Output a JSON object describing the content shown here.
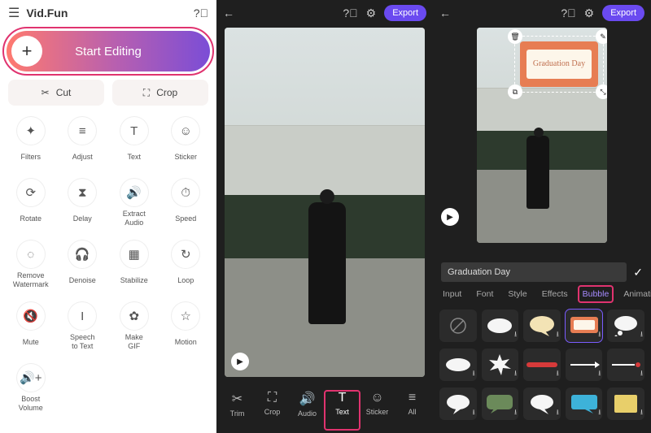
{
  "left": {
    "app_name": "Vid.Fun",
    "start_label": "Start Editing",
    "cut_label": "Cut",
    "crop_label": "Crop",
    "tools": [
      {
        "id": "filters",
        "label": "Filters",
        "icon": "✦"
      },
      {
        "id": "adjust",
        "label": "Adjust",
        "icon": "≡"
      },
      {
        "id": "text",
        "label": "Text",
        "icon": "T"
      },
      {
        "id": "sticker",
        "label": "Sticker",
        "icon": "☺"
      },
      {
        "id": "rotate",
        "label": "Rotate",
        "icon": "⟳"
      },
      {
        "id": "delay",
        "label": "Delay",
        "icon": "⧗"
      },
      {
        "id": "extract-audio",
        "label": "Extract Audio",
        "icon": "🔊"
      },
      {
        "id": "speed",
        "label": "Speed",
        "icon": "⏱"
      },
      {
        "id": "remove-watermark",
        "label": "Remove Watermark",
        "icon": "◌"
      },
      {
        "id": "denoise",
        "label": "Denoise",
        "icon": "🎧"
      },
      {
        "id": "stabilize",
        "label": "Stabilize",
        "icon": "▦"
      },
      {
        "id": "loop",
        "label": "Loop",
        "icon": "↻"
      },
      {
        "id": "mute",
        "label": "Mute",
        "icon": "🔇"
      },
      {
        "id": "speech-to-text",
        "label": "Speech to Text",
        "icon": "І"
      },
      {
        "id": "make-gif",
        "label": "Make GIF",
        "icon": "✿"
      },
      {
        "id": "motion",
        "label": "Motion",
        "icon": "☆"
      },
      {
        "id": "boost-volume",
        "label": "Boost Volume",
        "icon": "🔊+"
      }
    ]
  },
  "mid": {
    "export_label": "Export",
    "bottom": [
      {
        "id": "trim",
        "label": "Trim",
        "icon": "✂"
      },
      {
        "id": "crop",
        "label": "Crop",
        "icon": "⛶"
      },
      {
        "id": "audio",
        "label": "Audio",
        "icon": "🔊"
      },
      {
        "id": "text",
        "label": "Text",
        "icon": "T"
      },
      {
        "id": "sticker",
        "label": "Sticker",
        "icon": "☺"
      },
      {
        "id": "all",
        "label": "All",
        "icon": "≡"
      }
    ],
    "selected_tool": "text"
  },
  "right": {
    "export_label": "Export",
    "overlay_text": "Graduation Day",
    "input_value": "Graduation Day",
    "tabs": [
      "Input",
      "Font",
      "Style",
      "Effects",
      "Bubble",
      "Animation"
    ],
    "active_tab": "Bubble",
    "bubbles": [
      {
        "id": "none",
        "shape": "none"
      },
      {
        "id": "b1",
        "shape": "cloud-white"
      },
      {
        "id": "b2",
        "shape": "speech-cream"
      },
      {
        "id": "b3",
        "shape": "board-orange",
        "selected": true
      },
      {
        "id": "b4",
        "shape": "thought"
      },
      {
        "id": "b5",
        "shape": "oval-white"
      },
      {
        "id": "b6",
        "shape": "burst"
      },
      {
        "id": "b7",
        "shape": "bar-red"
      },
      {
        "id": "b8",
        "shape": "line-arrow"
      },
      {
        "id": "b9",
        "shape": "line-dot"
      },
      {
        "id": "b10",
        "shape": "speech-white"
      },
      {
        "id": "b11",
        "shape": "speech-green"
      },
      {
        "id": "b12",
        "shape": "speech-white2"
      },
      {
        "id": "b13",
        "shape": "speech-cyan"
      },
      {
        "id": "b14",
        "shape": "note-yellow"
      }
    ]
  }
}
